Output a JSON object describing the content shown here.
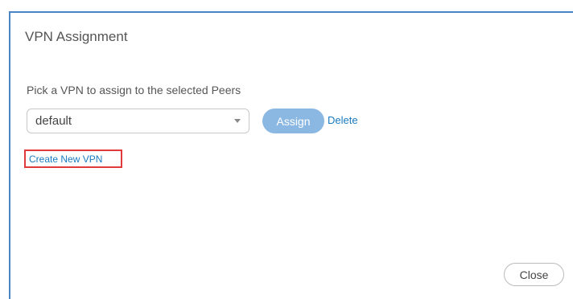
{
  "dialog": {
    "title": "VPN Assignment",
    "instruction": "Pick a VPN to assign to the selected Peers",
    "vpn_select": {
      "selected": "default"
    },
    "assign_label": "Assign",
    "delete_label": "Delete",
    "create_label": "Create New VPN",
    "close_label": "Close"
  },
  "colors": {
    "accent_border": "#4a86c5",
    "assign_bg": "#8bb8e3",
    "link": "#1a7abf",
    "highlight": "#e03a3a"
  }
}
